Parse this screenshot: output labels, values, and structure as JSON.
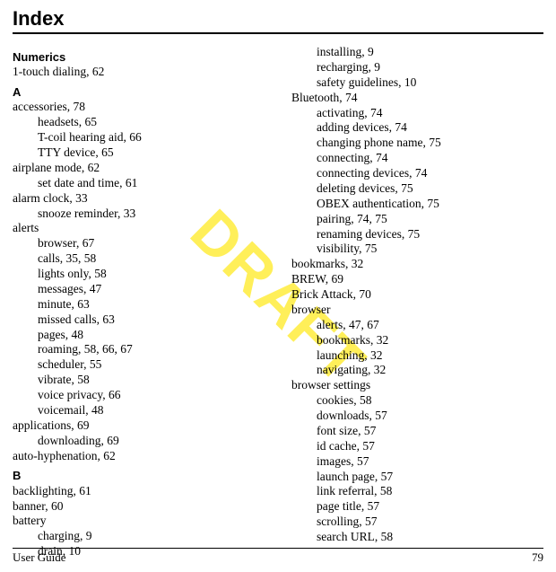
{
  "title": "Index",
  "watermark": "DRAFT",
  "footer": {
    "left": "User Guide",
    "right": "79"
  },
  "col1": [
    {
      "type": "head",
      "text": "Numerics"
    },
    {
      "type": "entry",
      "text": "1-touch dialing, 62"
    },
    {
      "type": "head",
      "text": "A"
    },
    {
      "type": "entry",
      "text": "accessories, 78"
    },
    {
      "type": "sub",
      "text": "headsets, 65"
    },
    {
      "type": "sub",
      "text": "T-coil hearing aid, 66"
    },
    {
      "type": "sub",
      "text": "TTY device, 65"
    },
    {
      "type": "entry",
      "text": "airplane mode, 62"
    },
    {
      "type": "sub",
      "text": "set date and time, 61"
    },
    {
      "type": "entry",
      "text": "alarm clock, 33"
    },
    {
      "type": "sub",
      "text": "snooze reminder, 33"
    },
    {
      "type": "entry",
      "text": "alerts"
    },
    {
      "type": "sub",
      "text": "browser, 67"
    },
    {
      "type": "sub",
      "text": "calls, 35, 58"
    },
    {
      "type": "sub",
      "text": "lights only, 58"
    },
    {
      "type": "sub",
      "text": "messages, 47"
    },
    {
      "type": "sub",
      "text": "minute, 63"
    },
    {
      "type": "sub",
      "text": "missed calls, 63"
    },
    {
      "type": "sub",
      "text": "pages, 48"
    },
    {
      "type": "sub",
      "text": "roaming, 58, 66, 67"
    },
    {
      "type": "sub",
      "text": "scheduler, 55"
    },
    {
      "type": "sub",
      "text": "vibrate, 58"
    },
    {
      "type": "sub",
      "text": "voice privacy, 66"
    },
    {
      "type": "sub",
      "text": "voicemail, 48"
    },
    {
      "type": "entry",
      "text": "applications, 69"
    },
    {
      "type": "sub",
      "text": "downloading, 69"
    },
    {
      "type": "entry",
      "text": "auto-hyphenation, 62"
    },
    {
      "type": "head",
      "text": "B"
    },
    {
      "type": "entry",
      "text": "backlighting, 61"
    },
    {
      "type": "entry",
      "text": "banner, 60"
    },
    {
      "type": "entry",
      "text": "battery"
    },
    {
      "type": "sub",
      "text": "charging, 9"
    },
    {
      "type": "sub",
      "text": "drain, 10"
    }
  ],
  "col2": [
    {
      "type": "sub",
      "text": "installing, 9"
    },
    {
      "type": "sub",
      "text": "recharging, 9"
    },
    {
      "type": "sub",
      "text": "safety guidelines, 10"
    },
    {
      "type": "entry",
      "text": "Bluetooth, 74"
    },
    {
      "type": "sub",
      "text": "activating, 74"
    },
    {
      "type": "sub",
      "text": "adding devices, 74"
    },
    {
      "type": "sub",
      "text": "changing phone name, 75"
    },
    {
      "type": "sub",
      "text": "connecting, 74"
    },
    {
      "type": "sub",
      "text": "connecting devices, 74"
    },
    {
      "type": "sub",
      "text": "deleting devices, 75"
    },
    {
      "type": "sub",
      "text": "OBEX authentication, 75"
    },
    {
      "type": "sub",
      "text": "pairing, 74, 75"
    },
    {
      "type": "sub",
      "text": "renaming devices, 75"
    },
    {
      "type": "sub",
      "text": "visibility, 75"
    },
    {
      "type": "entry",
      "text": "bookmarks, 32"
    },
    {
      "type": "entry",
      "text": "BREW, 69"
    },
    {
      "type": "entry",
      "text": "Brick Attack, 70"
    },
    {
      "type": "entry",
      "text": "browser"
    },
    {
      "type": "sub",
      "text": "alerts, 47, 67"
    },
    {
      "type": "sub",
      "text": "bookmarks, 32"
    },
    {
      "type": "sub",
      "text": "launching, 32"
    },
    {
      "type": "sub",
      "text": "navigating, 32"
    },
    {
      "type": "entry",
      "text": "browser settings"
    },
    {
      "type": "sub",
      "text": "cookies, 58"
    },
    {
      "type": "sub",
      "text": "downloads, 57"
    },
    {
      "type": "sub",
      "text": "font size, 57"
    },
    {
      "type": "sub",
      "text": "id cache, 57"
    },
    {
      "type": "sub",
      "text": "images, 57"
    },
    {
      "type": "sub",
      "text": "launch page, 57"
    },
    {
      "type": "sub",
      "text": "link referral, 58"
    },
    {
      "type": "sub",
      "text": "page title, 57"
    },
    {
      "type": "sub",
      "text": "scrolling, 57"
    },
    {
      "type": "sub",
      "text": "search URL, 58"
    }
  ]
}
